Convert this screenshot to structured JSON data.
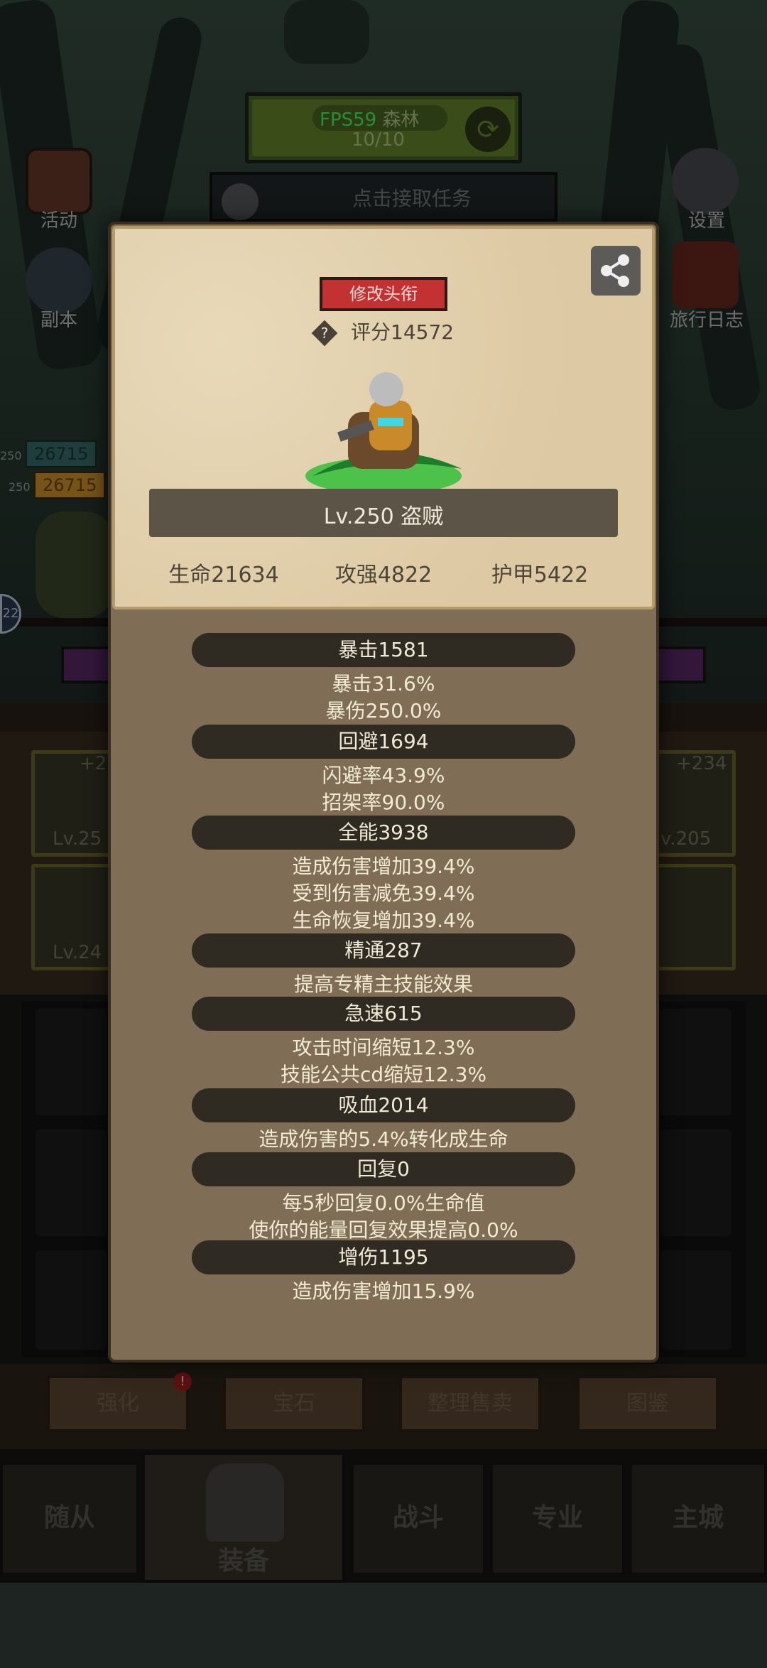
{
  "hud": {
    "fps": "FPS59",
    "stage_name": "森林",
    "stage_progress": "10/10",
    "quest_text": "点击接取任务",
    "left_icons": [
      {
        "icon": "activity-icon",
        "label": "活动"
      },
      {
        "icon": "dungeon-icon",
        "label": "副本"
      }
    ],
    "right_icons": [
      {
        "icon": "gear-icon",
        "label": "设置"
      },
      {
        "icon": "journal-icon",
        "label": "旅行日志"
      }
    ],
    "party_hp": [
      "26715",
      "26715"
    ],
    "party_level": [
      "250",
      "250"
    ],
    "avatar_badge": "22"
  },
  "equipment_bg": {
    "left_plus": "+2",
    "right_plus": "+234",
    "left_lv_1": "Lv.25",
    "right_lv_1": "v.205",
    "left_lv_2": "Lv.24"
  },
  "bottom_buttons": [
    "强化",
    "宝石",
    "整理售卖",
    "图鉴"
  ],
  "nav_tabs": [
    "随从",
    "装备",
    "战斗",
    "专业",
    "主城"
  ],
  "modal": {
    "title_button": "修改头衔",
    "score": "评分14572",
    "level_class": "Lv.250 盗贼",
    "top_stats": [
      "生命21634",
      "攻强4822",
      "护甲5422"
    ],
    "sections": [
      {
        "header": "暴击1581",
        "lines": [
          "暴击31.6%",
          "暴伤250.0%"
        ]
      },
      {
        "header": "回避1694",
        "lines": [
          "闪避率43.9%",
          "招架率90.0%"
        ]
      },
      {
        "header": "全能3938",
        "lines": [
          "造成伤害增加39.4%",
          "受到伤害减免39.4%",
          "生命恢复增加39.4%"
        ]
      },
      {
        "header": "精通287",
        "lines": [
          "提高专精主技能效果"
        ]
      },
      {
        "header": "急速615",
        "lines": [
          "攻击时间缩短12.3%",
          "技能公共cd缩短12.3%"
        ]
      },
      {
        "header": "吸血2014",
        "lines": [
          "造成伤害的5.4%转化成生命"
        ]
      },
      {
        "header": "回复0",
        "lines": [
          "每5秒回复0.0%生命值",
          "使你的能量回复效果提高0.0%"
        ]
      },
      {
        "header": "增伤1195",
        "lines": [
          "造成伤害增加15.9%"
        ]
      }
    ]
  },
  "colors": {
    "modal_bg": "#7f6d55",
    "card_bg": "#e2d1ae",
    "title_button": "#c23233",
    "fps_green": "#4dff6a"
  }
}
